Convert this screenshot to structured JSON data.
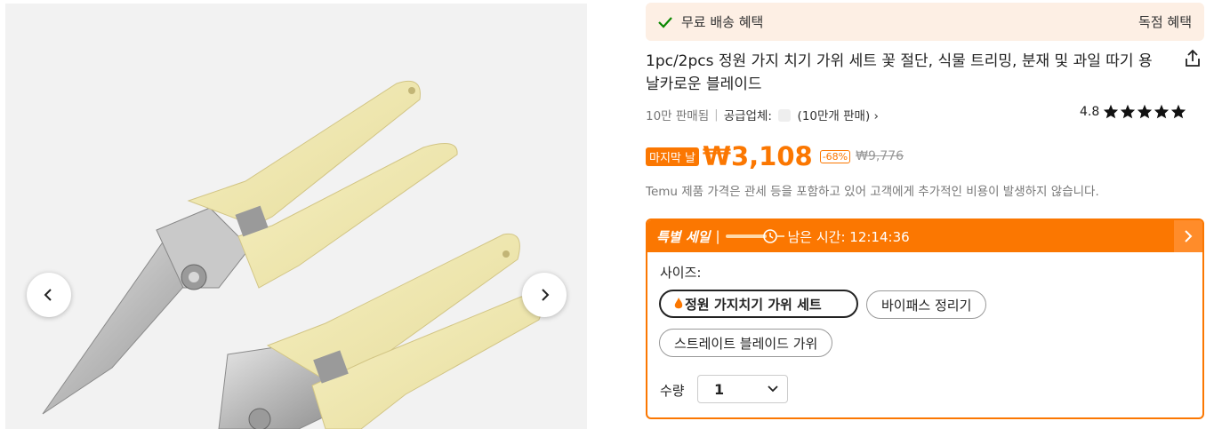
{
  "gallery": {
    "prev_icon": "chevron-left-icon",
    "next_icon": "chevron-right-icon"
  },
  "promo": {
    "text": "무료 배송 혜택",
    "right": "독점 혜택",
    "check_color": "#0a8800"
  },
  "product": {
    "title": "1pc/2pcs 정원 가지 치기 가위 세트 꽃 절단, 식물 트리밍, 분재 및 과일 따기 용 날카로운 블레이드",
    "sold": "10만 판매됨",
    "supplier_label": "공급업체:",
    "supplier_sales": "(10만개 판매)",
    "rating": "4.8",
    "stars": 4.8
  },
  "price": {
    "badge": "마지막 날",
    "current": "₩3,108",
    "discount": "-68%",
    "original": "₩9,776",
    "accent": "#fb7701"
  },
  "notice": "Temu 제품 가격은 관세 등을 포함하고 있어 고객에게 추가적인 비용이 발생하지 않습니다.",
  "sale": {
    "tag": "특별 세일",
    "remaining_label": "남은 시간: 12:14:36"
  },
  "size": {
    "label": "사이즈:",
    "options": [
      {
        "label": "정원 가지치기 가위 세트",
        "selected": true
      },
      {
        "label": "바이패스 정리기",
        "selected": false
      },
      {
        "label": "스트레이트 블레이드 가위",
        "selected": false
      }
    ]
  },
  "quantity": {
    "label": "수량",
    "value": "1"
  }
}
